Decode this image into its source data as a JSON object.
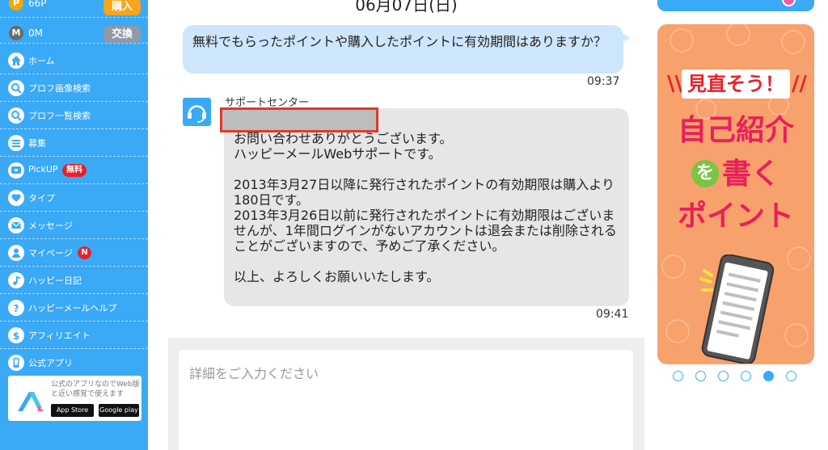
{
  "sidebar": {
    "points": {
      "icon": "P",
      "value": "66P",
      "button": "購入"
    },
    "money": {
      "icon": "M",
      "value": "0M",
      "button": "交換"
    },
    "items": [
      {
        "label": "ホーム",
        "icon": "home-icon"
      },
      {
        "label": "プロフ画像検索",
        "icon": "search-icon"
      },
      {
        "label": "プロフ一覧検索",
        "icon": "search-icon"
      },
      {
        "label": "募集",
        "icon": "list-icon"
      },
      {
        "label": "PickUP",
        "icon": "pickup-icon",
        "badge": "無料"
      },
      {
        "label": "タイプ",
        "icon": "heart-icon"
      },
      {
        "label": "メッセージ",
        "icon": "mail-icon"
      },
      {
        "label": "マイページ",
        "icon": "person-icon",
        "badge": "N"
      },
      {
        "label": "ハッピー日記",
        "icon": "music-note-icon"
      },
      {
        "label": "ハッピーメールヘルプ",
        "icon": "question-icon"
      },
      {
        "label": "アフィリエイト",
        "icon": "dollar-icon"
      },
      {
        "label": "公式アプリ",
        "icon": "phone-icon"
      }
    ],
    "app_card": {
      "description": "公式のアプリなのでWeb版と近い感覚で使えます",
      "app_store": "App Store",
      "google_play": "Google play"
    }
  },
  "chat": {
    "date": "06月07日(日)",
    "user_message": {
      "text": "無料でもらったポイントや購入したポイントに有効期間はありますか？",
      "time": "09:37"
    },
    "support_message": {
      "sender": "サポートセンター",
      "paragraphs": [
        "お問い合わせありがとうございます。\nハッピーメールWebサポートです。",
        "2013年3月27日以降に発行されたポイントの有効期限は購入より180日です。\n2013年3月26日以前に発行されたポイントに有効期限はございませんが、1年間ログインがないアカウントは退会または削除されることがございますので、予めご了承ください。",
        "以上、よろしくお願いいたします。"
      ],
      "time": "09:41"
    },
    "input": {
      "placeholder": "詳細をご入力ください",
      "value": ""
    }
  },
  "banner": {
    "headline": "見直そう！",
    "line1": "自己紹介",
    "line2_circle": "を",
    "line2_rest": "書く",
    "line3": "ポイント",
    "carousel_total": 6,
    "carousel_active": 5
  },
  "colors": {
    "sidebar": "#3aa9f6",
    "user_bubble": "#cde6fb",
    "support_bubble": "#e6e6e6",
    "banner_bg": "#f7a16d",
    "banner_text": "#e8205a",
    "badge": "#e8202a",
    "redaction_border": "#e2372b"
  }
}
